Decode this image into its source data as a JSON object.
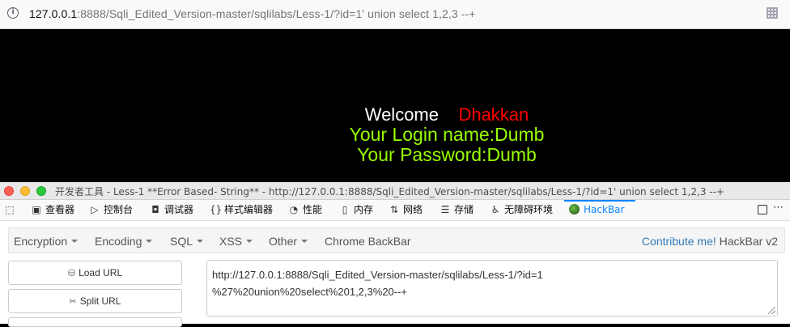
{
  "browser": {
    "url_host": "127.0.0.1",
    "url_rest": ":8888/Sqli_Edited_Version-master/sqlilabs/Less-1/?id=1' union select 1,2,3 --+"
  },
  "page": {
    "welcome": "Welcome",
    "user": "Dhakkan",
    "login_name": "Your Login name:Dumb",
    "password": "Your Password:Dumb"
  },
  "devtools": {
    "title": "开发者工具 - Less-1 **Error Based- String** - http://127.0.0.1:8888/Sqli_Edited_Version-master/sqlilabs/Less-1/?id=1' union select 1,2,3 --+",
    "tabs": [
      {
        "label": "查看器",
        "icon": "inspector-icon"
      },
      {
        "label": "控制台",
        "icon": "console-icon"
      },
      {
        "label": "调试器",
        "icon": "debugger-icon"
      },
      {
        "label": "样式编辑器",
        "icon": "style-editor-icon"
      },
      {
        "label": "性能",
        "icon": "performance-icon"
      },
      {
        "label": "内存",
        "icon": "memory-icon"
      },
      {
        "label": "网络",
        "icon": "network-icon"
      },
      {
        "label": "存储",
        "icon": "storage-icon"
      },
      {
        "label": "无障碍环境",
        "icon": "accessibility-icon"
      },
      {
        "label": "HackBar",
        "icon": "hackbar-icon",
        "active": true
      }
    ]
  },
  "hackbar": {
    "menu": {
      "encryption": "Encryption",
      "encoding": "Encoding",
      "sql": "SQL",
      "xss": "XSS",
      "other": "Other",
      "chrome_backbar": "Chrome BackBar",
      "contribute": "Contribute me!",
      "brand": "HackBar v2"
    },
    "load_url": "Load URL",
    "split_url": "Split URL",
    "url_line1": "http://127.0.0.1:8888/Sqli_Edited_Version-master/sqlilabs/Less-1/?id=1",
    "url_line2": "%27%20union%20select%201,2,3%20--+"
  },
  "colors": {
    "welcome_name": "#ff0000",
    "login_text": "#99ff00",
    "active_tab": "#0a84ff"
  }
}
